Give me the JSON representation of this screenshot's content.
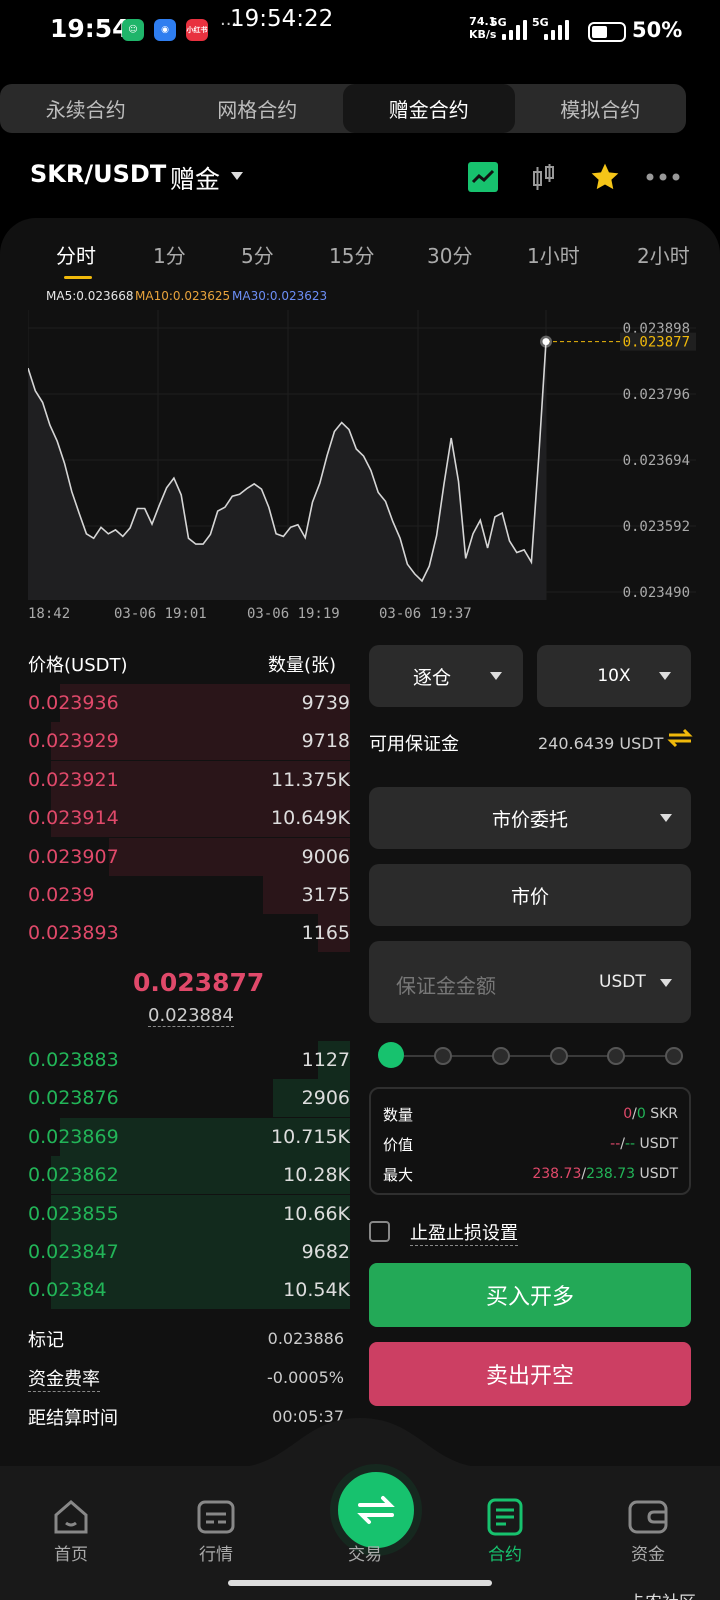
{
  "status": {
    "time": "19:54",
    "time_center": "19:54:22",
    "dots": "···",
    "net_speed": "74.1",
    "net_unit": "KB/s",
    "sig1_label": "5G",
    "sig2_label": "5G",
    "battery": "50%",
    "app_icon_text": "小红书"
  },
  "tabs": [
    {
      "label": "永续合约"
    },
    {
      "label": "网格合约"
    },
    {
      "label": "赠金合约"
    },
    {
      "label": "模拟合约"
    }
  ],
  "pair": {
    "symbol": "SKR/USDT",
    "tag": "赠金"
  },
  "timeframes": [
    {
      "label": "分时"
    },
    {
      "label": "1分"
    },
    {
      "label": "5分"
    },
    {
      "label": "15分"
    },
    {
      "label": "30分"
    },
    {
      "label": "1小时"
    },
    {
      "label": "2小时"
    }
  ],
  "ma": {
    "ma5": "MA5:0.023668",
    "ma10": "MA10:0.023625",
    "ma30": "MA30:0.023623",
    "ma5_color": "#e0e0e0",
    "ma10_color": "#e8a33c",
    "ma30_color": "#6c8ef5"
  },
  "chart_data": {
    "type": "line",
    "y_ticks": [
      "0.023898",
      "0.023796",
      "0.023694",
      "0.023592",
      "0.023490"
    ],
    "y_ticks_values": [
      0.023898,
      0.023796,
      0.023694,
      0.023592,
      0.02349
    ],
    "x_ticks": [
      "18:42",
      "03-06 19:01",
      "03-06 19:19",
      "03-06 19:37"
    ],
    "ylim": [
      0.02349,
      0.023898
    ],
    "last_price_label": "0.023877",
    "values": [
      0.023836,
      0.023801,
      0.023783,
      0.023748,
      0.023723,
      0.023689,
      0.023645,
      0.023612,
      0.02358,
      0.023573,
      0.02359,
      0.02358,
      0.023586,
      0.023576,
      0.023589,
      0.023619,
      0.023619,
      0.023595,
      0.023624,
      0.023651,
      0.023666,
      0.02364,
      0.023573,
      0.023564,
      0.023564,
      0.023579,
      0.023615,
      0.023621,
      0.023638,
      0.023641,
      0.02365,
      0.023657,
      0.023649,
      0.023621,
      0.02358,
      0.023576,
      0.02359,
      0.023594,
      0.023574,
      0.023629,
      0.023658,
      0.023701,
      0.023738,
      0.023752,
      0.023741,
      0.023711,
      0.0237,
      0.023678,
      0.023644,
      0.02363,
      0.023599,
      0.023573,
      0.023533,
      0.023518,
      0.023507,
      0.02353,
      0.023577,
      0.023656,
      0.023728,
      0.023661,
      0.023542,
      0.02358,
      0.023601,
      0.023558,
      0.023606,
      0.023612,
      0.023569,
      0.023551,
      0.023555,
      0.023536,
      0.023698,
      0.023877
    ],
    "grid": true
  },
  "orderbook": {
    "price_header": "价格(USDT)",
    "qty_header": "数量(张)",
    "asks": [
      {
        "price": "0.023936",
        "qty": "9739",
        "depth": 0.9
      },
      {
        "price": "0.023929",
        "qty": "9718",
        "depth": 0.93
      },
      {
        "price": "0.023921",
        "qty": "11.375K",
        "depth": 0.93
      },
      {
        "price": "0.023914",
        "qty": "10.649K",
        "depth": 0.93
      },
      {
        "price": "0.023907",
        "qty": "9006",
        "depth": 0.75
      },
      {
        "price": "0.0239",
        "qty": "3175",
        "depth": 0.27
      },
      {
        "price": "0.023893",
        "qty": "1165",
        "depth": 0.1
      }
    ],
    "mid_price": "0.023877",
    "mark_price_small": "0.023884",
    "bids": [
      {
        "price": "0.023883",
        "qty": "1127",
        "depth": 0.1
      },
      {
        "price": "0.023876",
        "qty": "2906",
        "depth": 0.24
      },
      {
        "price": "0.023869",
        "qty": "10.715K",
        "depth": 0.9
      },
      {
        "price": "0.023862",
        "qty": "10.28K",
        "depth": 0.93
      },
      {
        "price": "0.023855",
        "qty": "10.66K",
        "depth": 0.93
      },
      {
        "price": "0.023847",
        "qty": "9682",
        "depth": 0.93
      },
      {
        "price": "0.02384",
        "qty": "10.54K",
        "depth": 0.93
      }
    ]
  },
  "info": [
    {
      "label": "标记",
      "value": "0.023886"
    },
    {
      "label": "资金费率",
      "value": "-0.0005%"
    },
    {
      "label": "距结算时间",
      "value": "00:05:37"
    }
  ],
  "form": {
    "margin_mode": "逐仓",
    "leverage": "10X",
    "available_label": "可用保证金",
    "available_value": "240.6439 USDT",
    "order_type": "市价委托",
    "price_field": "市价",
    "amount_placeholder": "保证金金额",
    "amount_unit": "USDT",
    "slider_value": 0,
    "qty_label": "数量",
    "qty_a": "0",
    "qty_sep": "/",
    "qty_b": "0",
    "qty_unit": "SKR",
    "value_label": "价值",
    "value_a": "--",
    "value_sep": "/",
    "value_b": "--",
    "value_unit": "USDT",
    "max_label": "最大",
    "max_a": "238.73",
    "max_sep": "/",
    "max_b": "238.73",
    "max_unit": "USDT",
    "tpsl_label": "止盈止损设置",
    "buy_label": "买入开多",
    "sell_label": "卖出开空"
  },
  "nav": [
    {
      "label": "首页"
    },
    {
      "label": "行情"
    },
    {
      "label": "交易"
    },
    {
      "label": "合约"
    },
    {
      "label": "资金"
    }
  ],
  "watermark": "卡农社区",
  "colors": {
    "buy": "#23a957",
    "sell": "#cc3f63",
    "accent": "#17c26e",
    "star": "#f5c518"
  }
}
